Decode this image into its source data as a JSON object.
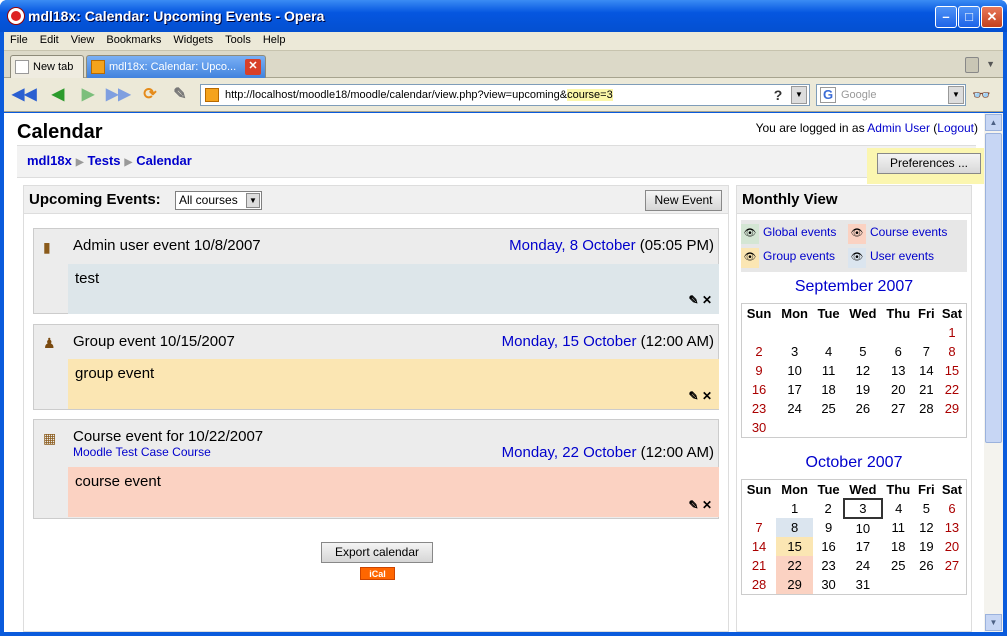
{
  "window": {
    "title": "mdl18x: Calendar: Upcoming Events - Opera"
  },
  "menu": [
    "File",
    "Edit",
    "View",
    "Bookmarks",
    "Widgets",
    "Tools",
    "Help"
  ],
  "tabs": [
    {
      "label": "New tab"
    },
    {
      "label": "mdl18x: Calendar: Upco..."
    }
  ],
  "address": {
    "url_main": "http://localhost/moodle18/moodle/calendar/view.php?view=upcoming&",
    "url_highlight": "course=3",
    "help_label": "?",
    "search_placeholder": "Google"
  },
  "page": {
    "heading": "Calendar",
    "login_prefix": "You are logged in as ",
    "login_user": "Admin User",
    "login_logout": "Logout",
    "breadcrumb": [
      "mdl18x",
      "Tests",
      "Calendar"
    ],
    "preferences_label": "Preferences ..."
  },
  "upcoming": {
    "title": "Upcoming Events:",
    "course_filter": "All courses",
    "new_event_label": "New Event",
    "events": [
      {
        "name": "Admin user event 10/8/2007",
        "date_link": "Monday, 8 October",
        "time": " (05:05 PM)",
        "body": "test",
        "course_link": "",
        "color": "#dde6ea"
      },
      {
        "name": "Group event 10/15/2007",
        "date_link": "Monday, 15 October",
        "time": " (12:00 AM)",
        "body": "group event",
        "course_link": "",
        "color": "#fbe6b3"
      },
      {
        "name": "Course event for 10/22/2007",
        "date_link": "Monday, 22 October",
        "time": " (12:00 AM)",
        "body": "course event",
        "course_link": "Moodle Test Case Course",
        "color": "#fbd2c2"
      }
    ],
    "export_label": "Export calendar",
    "ical_label": "iCal"
  },
  "monthly": {
    "title": "Monthly View",
    "legend": [
      {
        "label": "Global events",
        "color": "#d4e6d4"
      },
      {
        "label": "Course events",
        "color": "#fbd2c2"
      },
      {
        "label": "Group events",
        "color": "#fbe6b3"
      },
      {
        "label": "User events",
        "color": "#dbe5ef"
      }
    ],
    "weekdays": [
      "Sun",
      "Mon",
      "Tue",
      "Wed",
      "Thu",
      "Fri",
      "Sat"
    ],
    "months": [
      {
        "name": "September 2007",
        "weeks": [
          [
            "",
            "",
            "",
            "",
            "",
            "",
            "1"
          ],
          [
            "2",
            "3",
            "4",
            "5",
            "6",
            "7",
            "8"
          ],
          [
            "9",
            "10",
            "11",
            "12",
            "13",
            "14",
            "15"
          ],
          [
            "16",
            "17",
            "18",
            "19",
            "20",
            "21",
            "22"
          ],
          [
            "23",
            "24",
            "25",
            "26",
            "27",
            "28",
            "29"
          ],
          [
            "30",
            "",
            "",
            "",
            "",
            "",
            ""
          ]
        ]
      },
      {
        "name": "October 2007",
        "weeks": [
          [
            "",
            "1",
            "2",
            "3",
            "4",
            "5",
            "6"
          ],
          [
            "7",
            "8",
            "9",
            "10",
            "11",
            "12",
            "13"
          ],
          [
            "14",
            "15",
            "16",
            "17",
            "18",
            "19",
            "20"
          ],
          [
            "21",
            "22",
            "23",
            "24",
            "25",
            "26",
            "27"
          ],
          [
            "28",
            "29",
            "30",
            "31",
            "",
            "",
            ""
          ]
        ],
        "today": "3",
        "event_days": {
          "8": "user",
          "15": "group",
          "22": "course",
          "29": "course"
        }
      }
    ]
  }
}
